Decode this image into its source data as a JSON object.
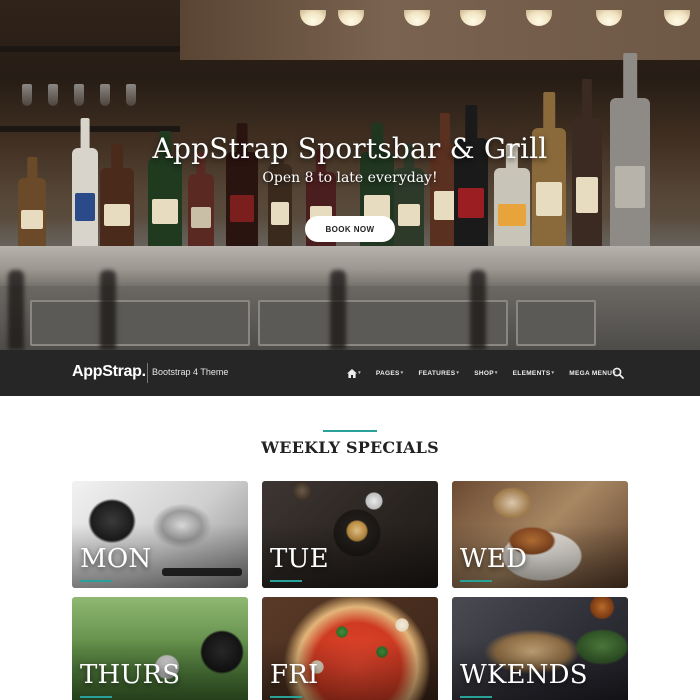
{
  "hero": {
    "title": "AppStrap Sportsbar & Grill",
    "subtitle": "Open 8 to late everyday!",
    "button_label": "BOOK NOW"
  },
  "navbar": {
    "brand": "AppStrap.",
    "tagline": "Bootstrap 4 Theme",
    "items": [
      {
        "label": "",
        "icon": "home-icon"
      },
      {
        "label": "PAGES"
      },
      {
        "label": "FEATURES"
      },
      {
        "label": "SHOP"
      },
      {
        "label": "ELEMENTS"
      },
      {
        "label": "MEGA MENU"
      }
    ],
    "search_icon": "search-icon"
  },
  "specials": {
    "title": "WEEKLY SPECIALS",
    "cards": [
      {
        "day": "MON"
      },
      {
        "day": "TUE"
      },
      {
        "day": "WED"
      },
      {
        "day": "THURS"
      },
      {
        "day": "FRI"
      },
      {
        "day": "WKENDS"
      }
    ]
  },
  "colors": {
    "accent": "#2aa198",
    "navbar_bg": "#262626"
  }
}
